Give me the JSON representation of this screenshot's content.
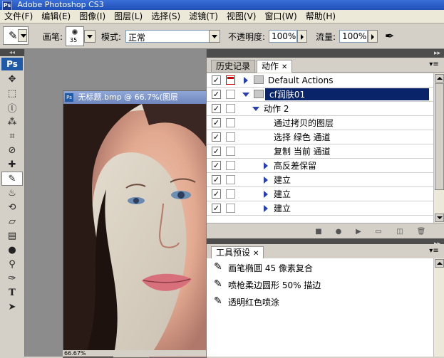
{
  "app": {
    "title": "Adobe Photoshop CS3",
    "logo": "Ps"
  },
  "menu": [
    {
      "id": "file",
      "label": "文件(F)"
    },
    {
      "id": "edit",
      "label": "编辑(E)"
    },
    {
      "id": "image",
      "label": "图像(I)"
    },
    {
      "id": "layer",
      "label": "图层(L)"
    },
    {
      "id": "select",
      "label": "选择(S)"
    },
    {
      "id": "filter",
      "label": "滤镜(T)"
    },
    {
      "id": "view",
      "label": "视图(V)"
    },
    {
      "id": "window",
      "label": "窗口(W)"
    },
    {
      "id": "help",
      "label": "帮助(H)"
    }
  ],
  "options": {
    "brush_label": "画笔:",
    "brush_size": "35",
    "mode_label": "模式:",
    "mode_value": "正常",
    "opacity_label": "不透明度:",
    "opacity_value": "100%",
    "flow_label": "流量:",
    "flow_value": "100%"
  },
  "toolbox": {
    "logo": "Ps",
    "grip": "◂◂"
  },
  "document": {
    "title": "无标题.bmp @ 66.7%(图层",
    "ps_mini": "Ps",
    "zoom": "66.67%"
  },
  "actions_panel": {
    "tabs": [
      {
        "label": "历史记录",
        "active": false
      },
      {
        "label": "动作",
        "active": true,
        "closable": true
      }
    ],
    "rows": [
      {
        "checked": true,
        "dialog": true,
        "indent": 0,
        "expander": "right",
        "folder": true,
        "label": "Default Actions",
        "selected": false
      },
      {
        "checked": true,
        "dialog": false,
        "indent": 0,
        "expander": "down",
        "folder": true,
        "label": "cf润肤01",
        "selected": true
      },
      {
        "checked": true,
        "dialog": false,
        "indent": 1,
        "expander": "down",
        "folder": false,
        "label": "动作 2",
        "selected": false
      },
      {
        "checked": true,
        "dialog": false,
        "indent": 2,
        "expander": "none",
        "folder": false,
        "label": "通过拷贝的图层",
        "selected": false
      },
      {
        "checked": true,
        "dialog": false,
        "indent": 2,
        "expander": "none",
        "folder": false,
        "label": "选择 绿色 通道",
        "selected": false
      },
      {
        "checked": true,
        "dialog": false,
        "indent": 2,
        "expander": "none",
        "folder": false,
        "label": "复制 当前 通道",
        "selected": false
      },
      {
        "checked": true,
        "dialog": false,
        "indent": 2,
        "expander": "right",
        "folder": false,
        "label": "高反差保留",
        "selected": false
      },
      {
        "checked": true,
        "dialog": false,
        "indent": 2,
        "expander": "right",
        "folder": false,
        "label": "建立",
        "selected": false
      },
      {
        "checked": true,
        "dialog": false,
        "indent": 2,
        "expander": "right",
        "folder": false,
        "label": "建立",
        "selected": false
      },
      {
        "checked": true,
        "dialog": false,
        "indent": 2,
        "expander": "right",
        "folder": false,
        "label": "建立",
        "selected": false
      }
    ]
  },
  "presets_panel": {
    "tab_label": "工具预设",
    "items": [
      {
        "label": "画笔椭圆 45 像素复合"
      },
      {
        "label": "喷枪柔边圆形 50% 描边"
      },
      {
        "label": "透明红色喷涂"
      }
    ]
  },
  "colors": {
    "title_bar": "#1f4fb6",
    "selection": "#0a246a",
    "action_triangle": "#2a3fb0",
    "dialog_toggle": "#cc0000"
  }
}
